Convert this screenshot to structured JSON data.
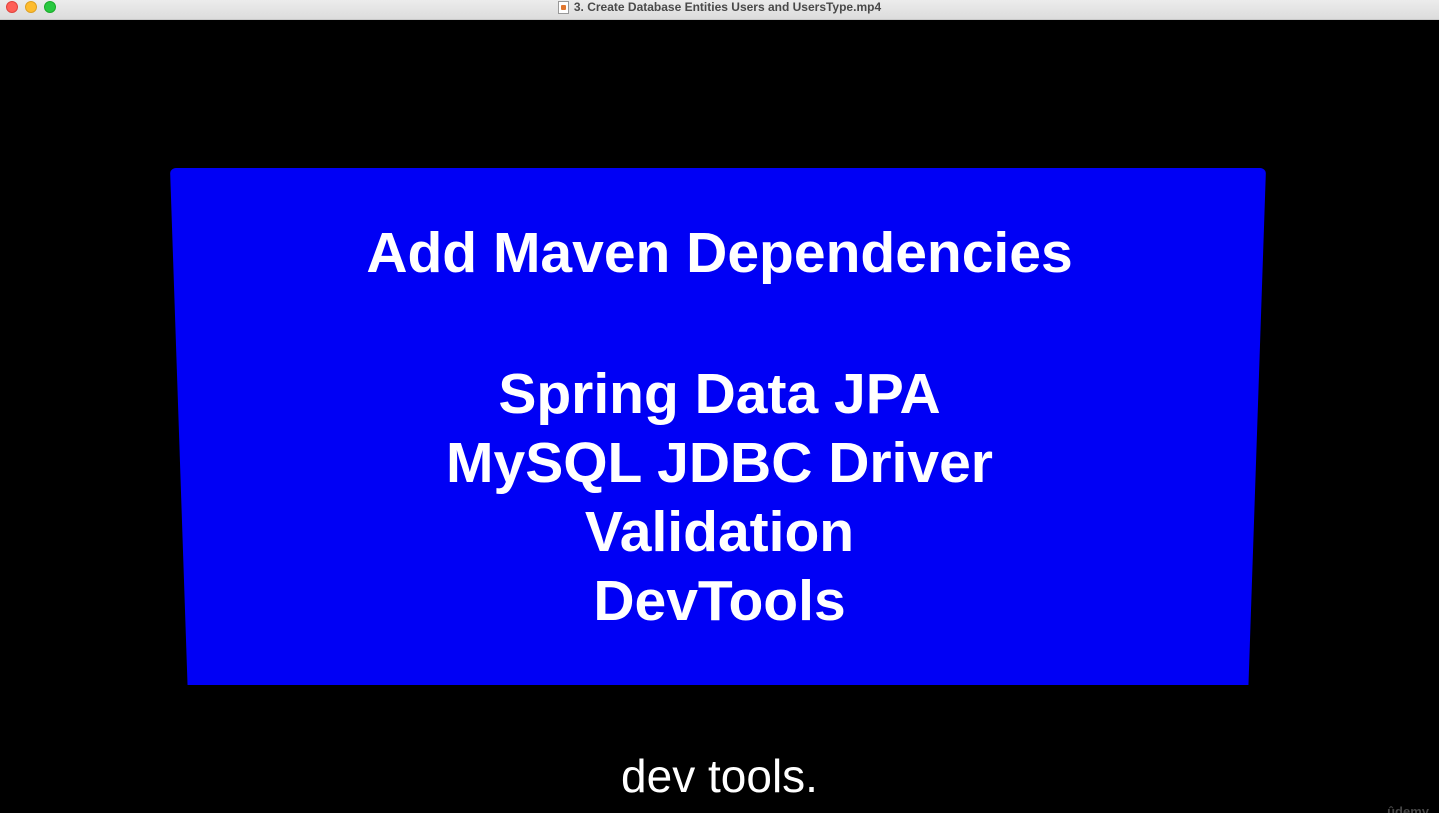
{
  "window": {
    "title": "3. Create Database Entities Users and UsersType.mp4"
  },
  "slide": {
    "heading": "Add Maven Dependencies",
    "items": [
      "Spring Data JPA",
      "MySQL JDBC Driver",
      "Validation",
      "DevTools"
    ],
    "background_color": "#0000f5"
  },
  "subtitle": "dev tools.",
  "watermark": "ûdemy"
}
